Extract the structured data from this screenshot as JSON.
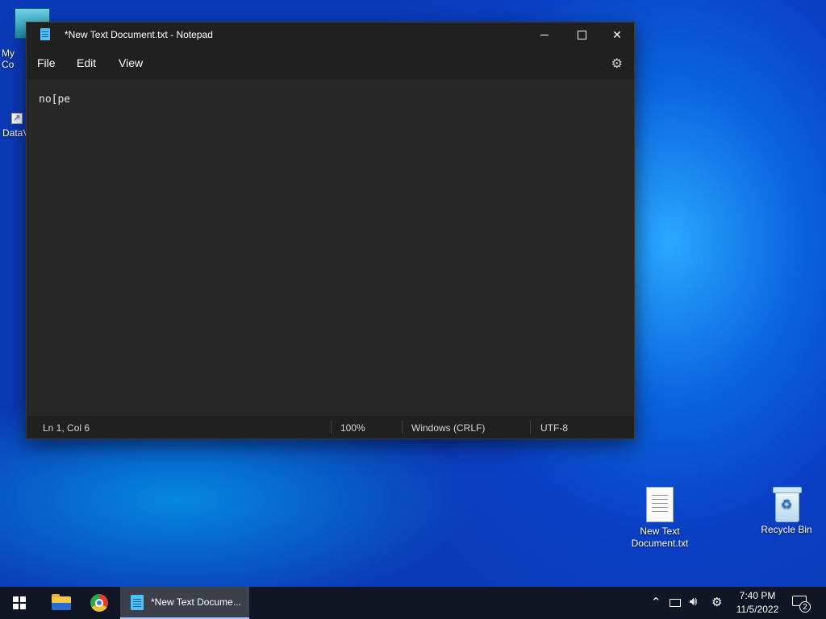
{
  "desktop": {
    "icons": [
      {
        "label": "New Text\nDocument.txt",
        "icon": "text-file-icon"
      },
      {
        "label": "Recycle Bin",
        "icon": "recycle-bin-icon"
      }
    ],
    "edge_icons": [
      {
        "label": "My Co",
        "icon": "computer-icon"
      },
      {
        "label": "DataV",
        "icon": "shortcut-icon"
      }
    ]
  },
  "notepad": {
    "title": "*New Text Document.txt - Notepad",
    "menu": [
      "File",
      "Edit",
      "View"
    ],
    "content": "no[pe",
    "status": {
      "position": "Ln 1, Col 6",
      "zoom": "100%",
      "line_ending": "Windows (CRLF)",
      "encoding": "UTF-8"
    },
    "controls": {
      "minimize": "—",
      "maximize": "☐",
      "close": "✕"
    }
  },
  "taskbar": {
    "active_app_label": "*New Text Docume...",
    "time": "7:40 PM",
    "date": "11/5/2022",
    "notification_count": "2"
  }
}
